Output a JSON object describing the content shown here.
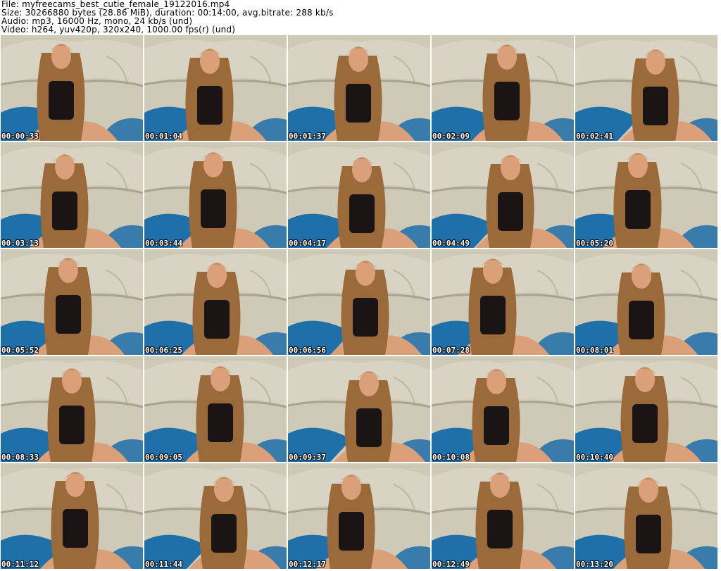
{
  "header": {
    "file_line": "File: myfreecams_best_cutie_female_19122016.mp4",
    "size_line": "Size: 30266880 bytes (28.86 MiB), duration: 00:14:00, avg.bitrate: 288 kb/s",
    "audio_line": "Audio: mp3, 16000 Hz, mono, 24 kb/s (und)",
    "video_line": "Video: h264, yuv420p, 320x240, 1000.00 fps(r) (und)"
  },
  "thumbnails": [
    {
      "timestamp": "00:00:33"
    },
    {
      "timestamp": "00:01:04"
    },
    {
      "timestamp": "00:01:37"
    },
    {
      "timestamp": "00:02:09"
    },
    {
      "timestamp": "00:02:41"
    },
    {
      "timestamp": "00:03:13"
    },
    {
      "timestamp": "00:03:44"
    },
    {
      "timestamp": "00:04:17"
    },
    {
      "timestamp": "00:04:49"
    },
    {
      "timestamp": "00:05:20"
    },
    {
      "timestamp": "00:05:52"
    },
    {
      "timestamp": "00:06:25"
    },
    {
      "timestamp": "00:06:56"
    },
    {
      "timestamp": "00:07:28"
    },
    {
      "timestamp": "00:08:01"
    },
    {
      "timestamp": "00:08:33"
    },
    {
      "timestamp": "00:09:05"
    },
    {
      "timestamp": "00:09:37"
    },
    {
      "timestamp": "00:10:08"
    },
    {
      "timestamp": "00:10:40"
    },
    {
      "timestamp": "00:11:12"
    },
    {
      "timestamp": "00:11:44"
    },
    {
      "timestamp": "00:12:17"
    },
    {
      "timestamp": "00:12:49"
    },
    {
      "timestamp": "00:13:20"
    }
  ],
  "colors": {
    "background": "#ffffff",
    "sofa": "#cfcab8",
    "sofa_shadow": "#a9a391",
    "blanket": "#1f6fa8",
    "hair": "#9a6a3a",
    "skin": "#d9a07a",
    "top": "#1a1414",
    "timestamp_text": "#ffffff"
  }
}
